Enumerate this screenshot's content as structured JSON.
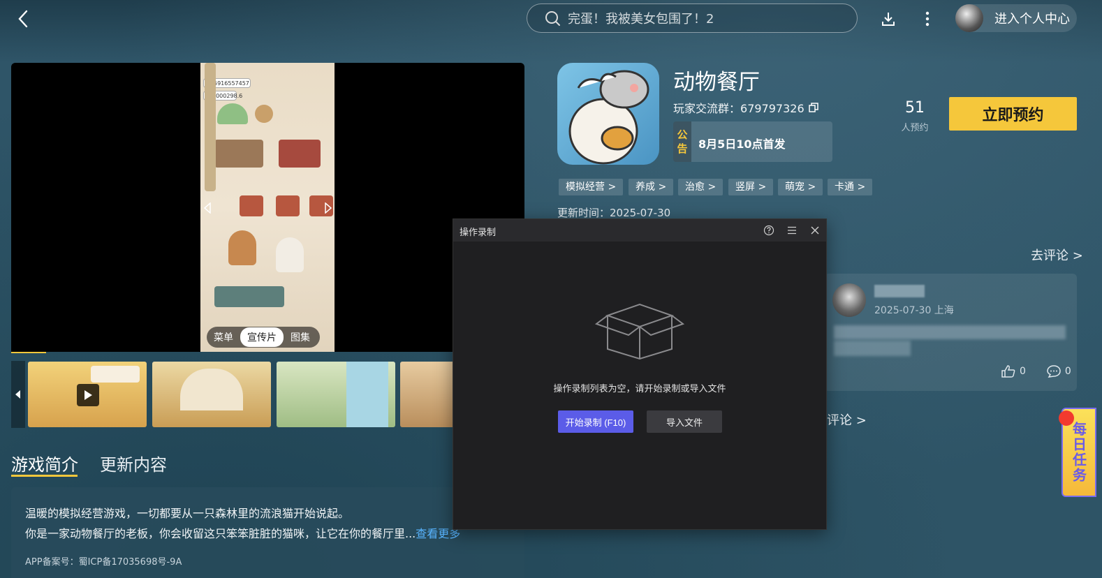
{
  "header": {
    "search_text": "完蛋！我被美女包围了！2",
    "user_center_label": "进入个人中心"
  },
  "video": {
    "tabs": [
      "菜单",
      "宣传片",
      "图集"
    ],
    "active_tab": "宣传片",
    "hud": {
      "coins": "5916557457",
      "stars": "1000298.6"
    }
  },
  "intro": {
    "tabs": [
      "游戏简介",
      "更新内容"
    ],
    "line1": "温暖的模拟经营游戏，一切都要从一只森林里的流浪猫开始说起。",
    "line2": "你是一家动物餐厅的老板，你会收留这只笨笨脏脏的猫咪，让它在你的餐厅里...",
    "more_link": "查看更多",
    "icp": "APP备案号：蜀ICP备17035698号-9A"
  },
  "game": {
    "title": "动物餐厅",
    "group_label": "玩家交流群：",
    "group_id": "679797326",
    "notice_tag": "公告",
    "notice_text": "8月5日10点首发",
    "reserve_count": "51",
    "reserve_label": "人预约",
    "reserve_button": "立即预约",
    "tags": [
      "模拟经营 >",
      "养成 >",
      "治愈 >",
      "竖屏 >",
      "萌宠 >",
      "卡通 >"
    ],
    "update_time": "更新时间：2025-07-30"
  },
  "comments": {
    "go_comment": "去评论 >",
    "date_location": "2025-07-30 上海",
    "likes": "0",
    "replies": "0",
    "more_comments": "评论 >"
  },
  "daily_task": "每日任务",
  "recorder": {
    "title": "操作录制",
    "empty_message": "操作录制列表为空，请开始录制或导入文件",
    "start_button": "开始录制 (F10)",
    "import_button": "导入文件"
  },
  "colors": {
    "accent_yellow": "#f5c73b",
    "link_blue": "#58b4ff",
    "record_purple": "#5b5ce8",
    "background": "#2f5466"
  }
}
